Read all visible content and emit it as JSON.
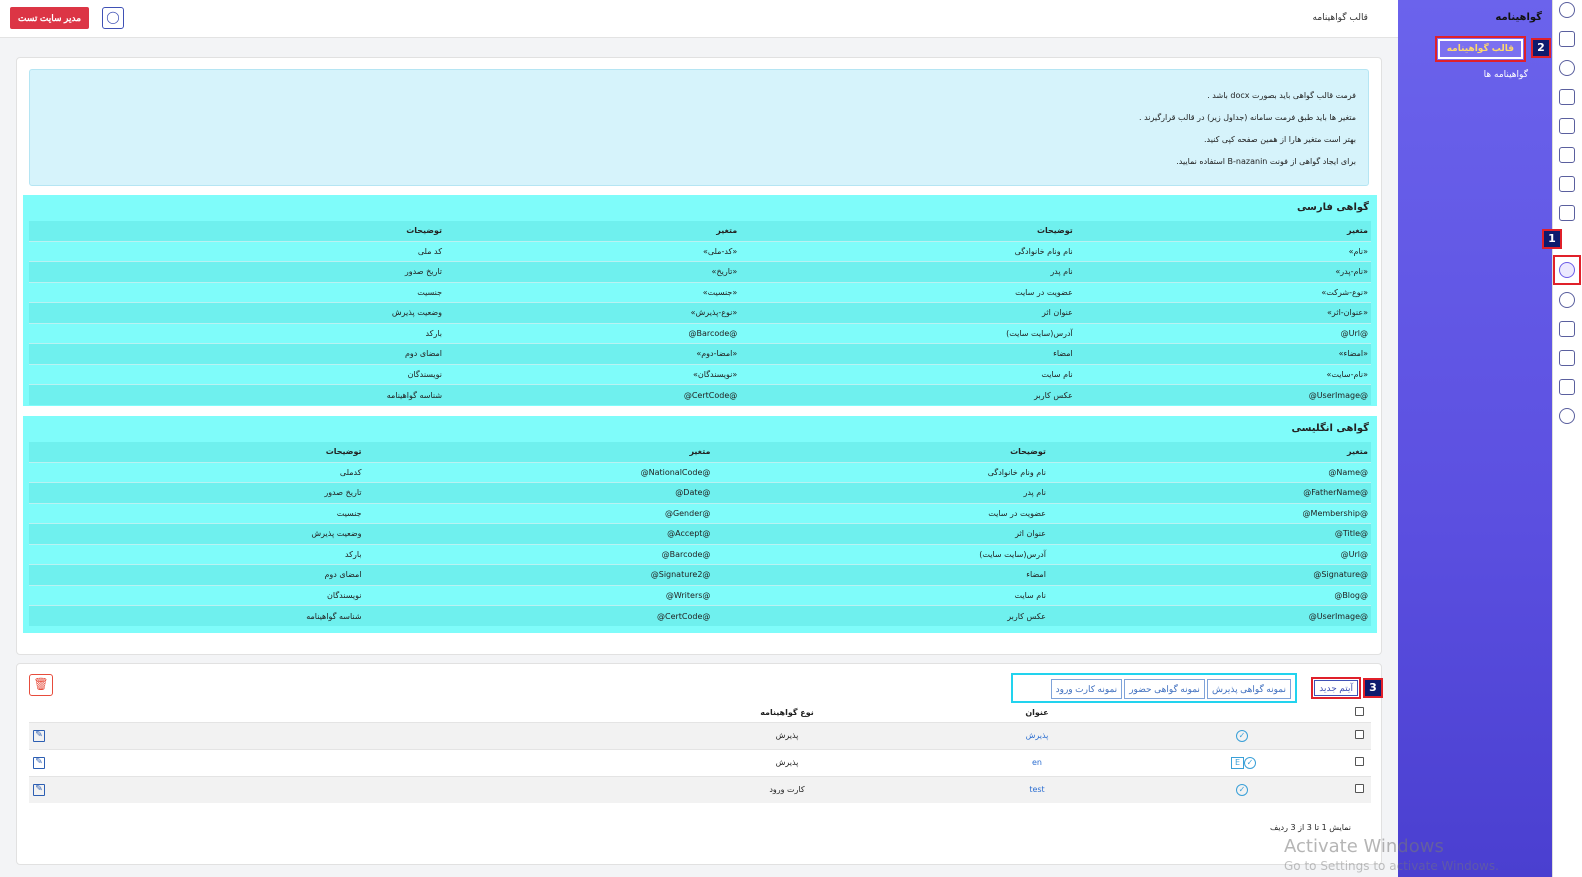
{
  "topbar": {
    "page_title": "قالب گواهینامه",
    "admin_button": "مدیر سایت تست",
    "bulb_icon": "lightbulb-icon"
  },
  "sidebar": {
    "section_title": "گواهینامه",
    "items": [
      {
        "label": "قالب گواهینامه",
        "active": true
      },
      {
        "label": "گواهینامه ها",
        "active": false
      }
    ],
    "rail_icons": [
      "globe-icon",
      "grid-icon",
      "settings-icon",
      "table-icon",
      "image-icon",
      "users-icon",
      "book-icon",
      "check-square-icon",
      "certificate-icon",
      "help-icon",
      "list-icon",
      "store-icon",
      "mail-icon",
      "chat-icon"
    ]
  },
  "annotations": {
    "badge1": "1",
    "badge2": "2",
    "badge3": "3"
  },
  "info": {
    "lines": [
      "فرمت قالب گواهی باید بصورت docx باشد .",
      "متغیر ها باید طبق فرمت سامانه (جداول زیر) در قالب قرارگیرند .",
      "بهتر است متغیر هارا از همین صفحه کپی کنید.",
      "برای ایجاد گواهی از فونت B-nazanin استفاده نمایید."
    ]
  },
  "persian_cert": {
    "title": "گواهی فارسی",
    "headers": [
      "متغیر",
      "توضیحات",
      "متغیر",
      "توضیحات"
    ],
    "rows": [
      [
        "«نام»",
        "نام ونام خانوادگی",
        "«کد-ملی»",
        "کد ملی"
      ],
      [
        "«نام-پدر»",
        "نام پدر",
        "«تاریخ»",
        "تاریخ صدور"
      ],
      [
        "«نوع-شرکت»",
        "عضویت در سایت",
        "«جنسیت»",
        "جنسیت"
      ],
      [
        "«عنوان-اثر»",
        "عنوان اثر",
        "«نوع-پذیرش»",
        "وضعیت پذیرش"
      ],
      [
        "@Url@",
        "آدرس(سایت سایت)",
        "@Barcode@",
        "بارکد"
      ],
      [
        "«امضاء»",
        "امضاء",
        "«امضا-دوم»",
        "امضای دوم"
      ],
      [
        "«نام-سایت»",
        "نام سایت",
        "«نویسندگان»",
        "نویسندگان"
      ],
      [
        "@UserImage@",
        "عکس کاربر",
        "@CertCode@",
        "شناسه گواهینامه"
      ]
    ]
  },
  "english_cert": {
    "title": "گواهی انگلیسی",
    "headers": [
      "متغیر",
      "توضیحات",
      "متغیر",
      "توضیحات"
    ],
    "rows": [
      [
        "@Name@",
        "نام ونام خانوادگی",
        "@NationalCode@",
        "کدملی"
      ],
      [
        "@FatherName@",
        "نام پدر",
        "@Date@",
        "تاریخ صدور"
      ],
      [
        "@Membership@",
        "عضویت در سایت",
        "@Gender@",
        "جنسیت"
      ],
      [
        "@Title@",
        "عنوان اثر",
        "@Accept@",
        "وضعیت پذیرش"
      ],
      [
        "@Url@",
        "آدرس(سایت سایت)",
        "@Barcode@",
        "بارکد"
      ],
      [
        "@Signature@",
        "امضاء",
        "@Signature2@",
        "امضای دوم"
      ],
      [
        "@Blog@",
        "نام سایت",
        "@Writers@",
        "نویسندگان"
      ],
      [
        "@UserImage@",
        "عکس کاربر",
        "@CertCode@",
        "شناسه گواهینامه"
      ]
    ]
  },
  "list": {
    "new_item_button": "آیتم جدید",
    "sample_buttons": [
      "نمونه گواهی پذیرش",
      "نمونه گواهی حضور",
      "نمونه کارت ورود"
    ],
    "columns": {
      "title": "عنوان",
      "type": "نوع گواهینامه"
    },
    "rows": [
      {
        "title": "پذیرش",
        "type": "پذیرش",
        "has_e": false
      },
      {
        "title": "en",
        "type": "پذیرش",
        "has_e": true
      },
      {
        "title": "test",
        "type": "کارت ورود",
        "has_e": false
      }
    ],
    "e_label": "E",
    "pager": "نمایش 1 تا 3 از 3 ردیف"
  },
  "watermark": {
    "title": "Activate Windows",
    "subtitle": "Go to Settings to activate Windows."
  }
}
